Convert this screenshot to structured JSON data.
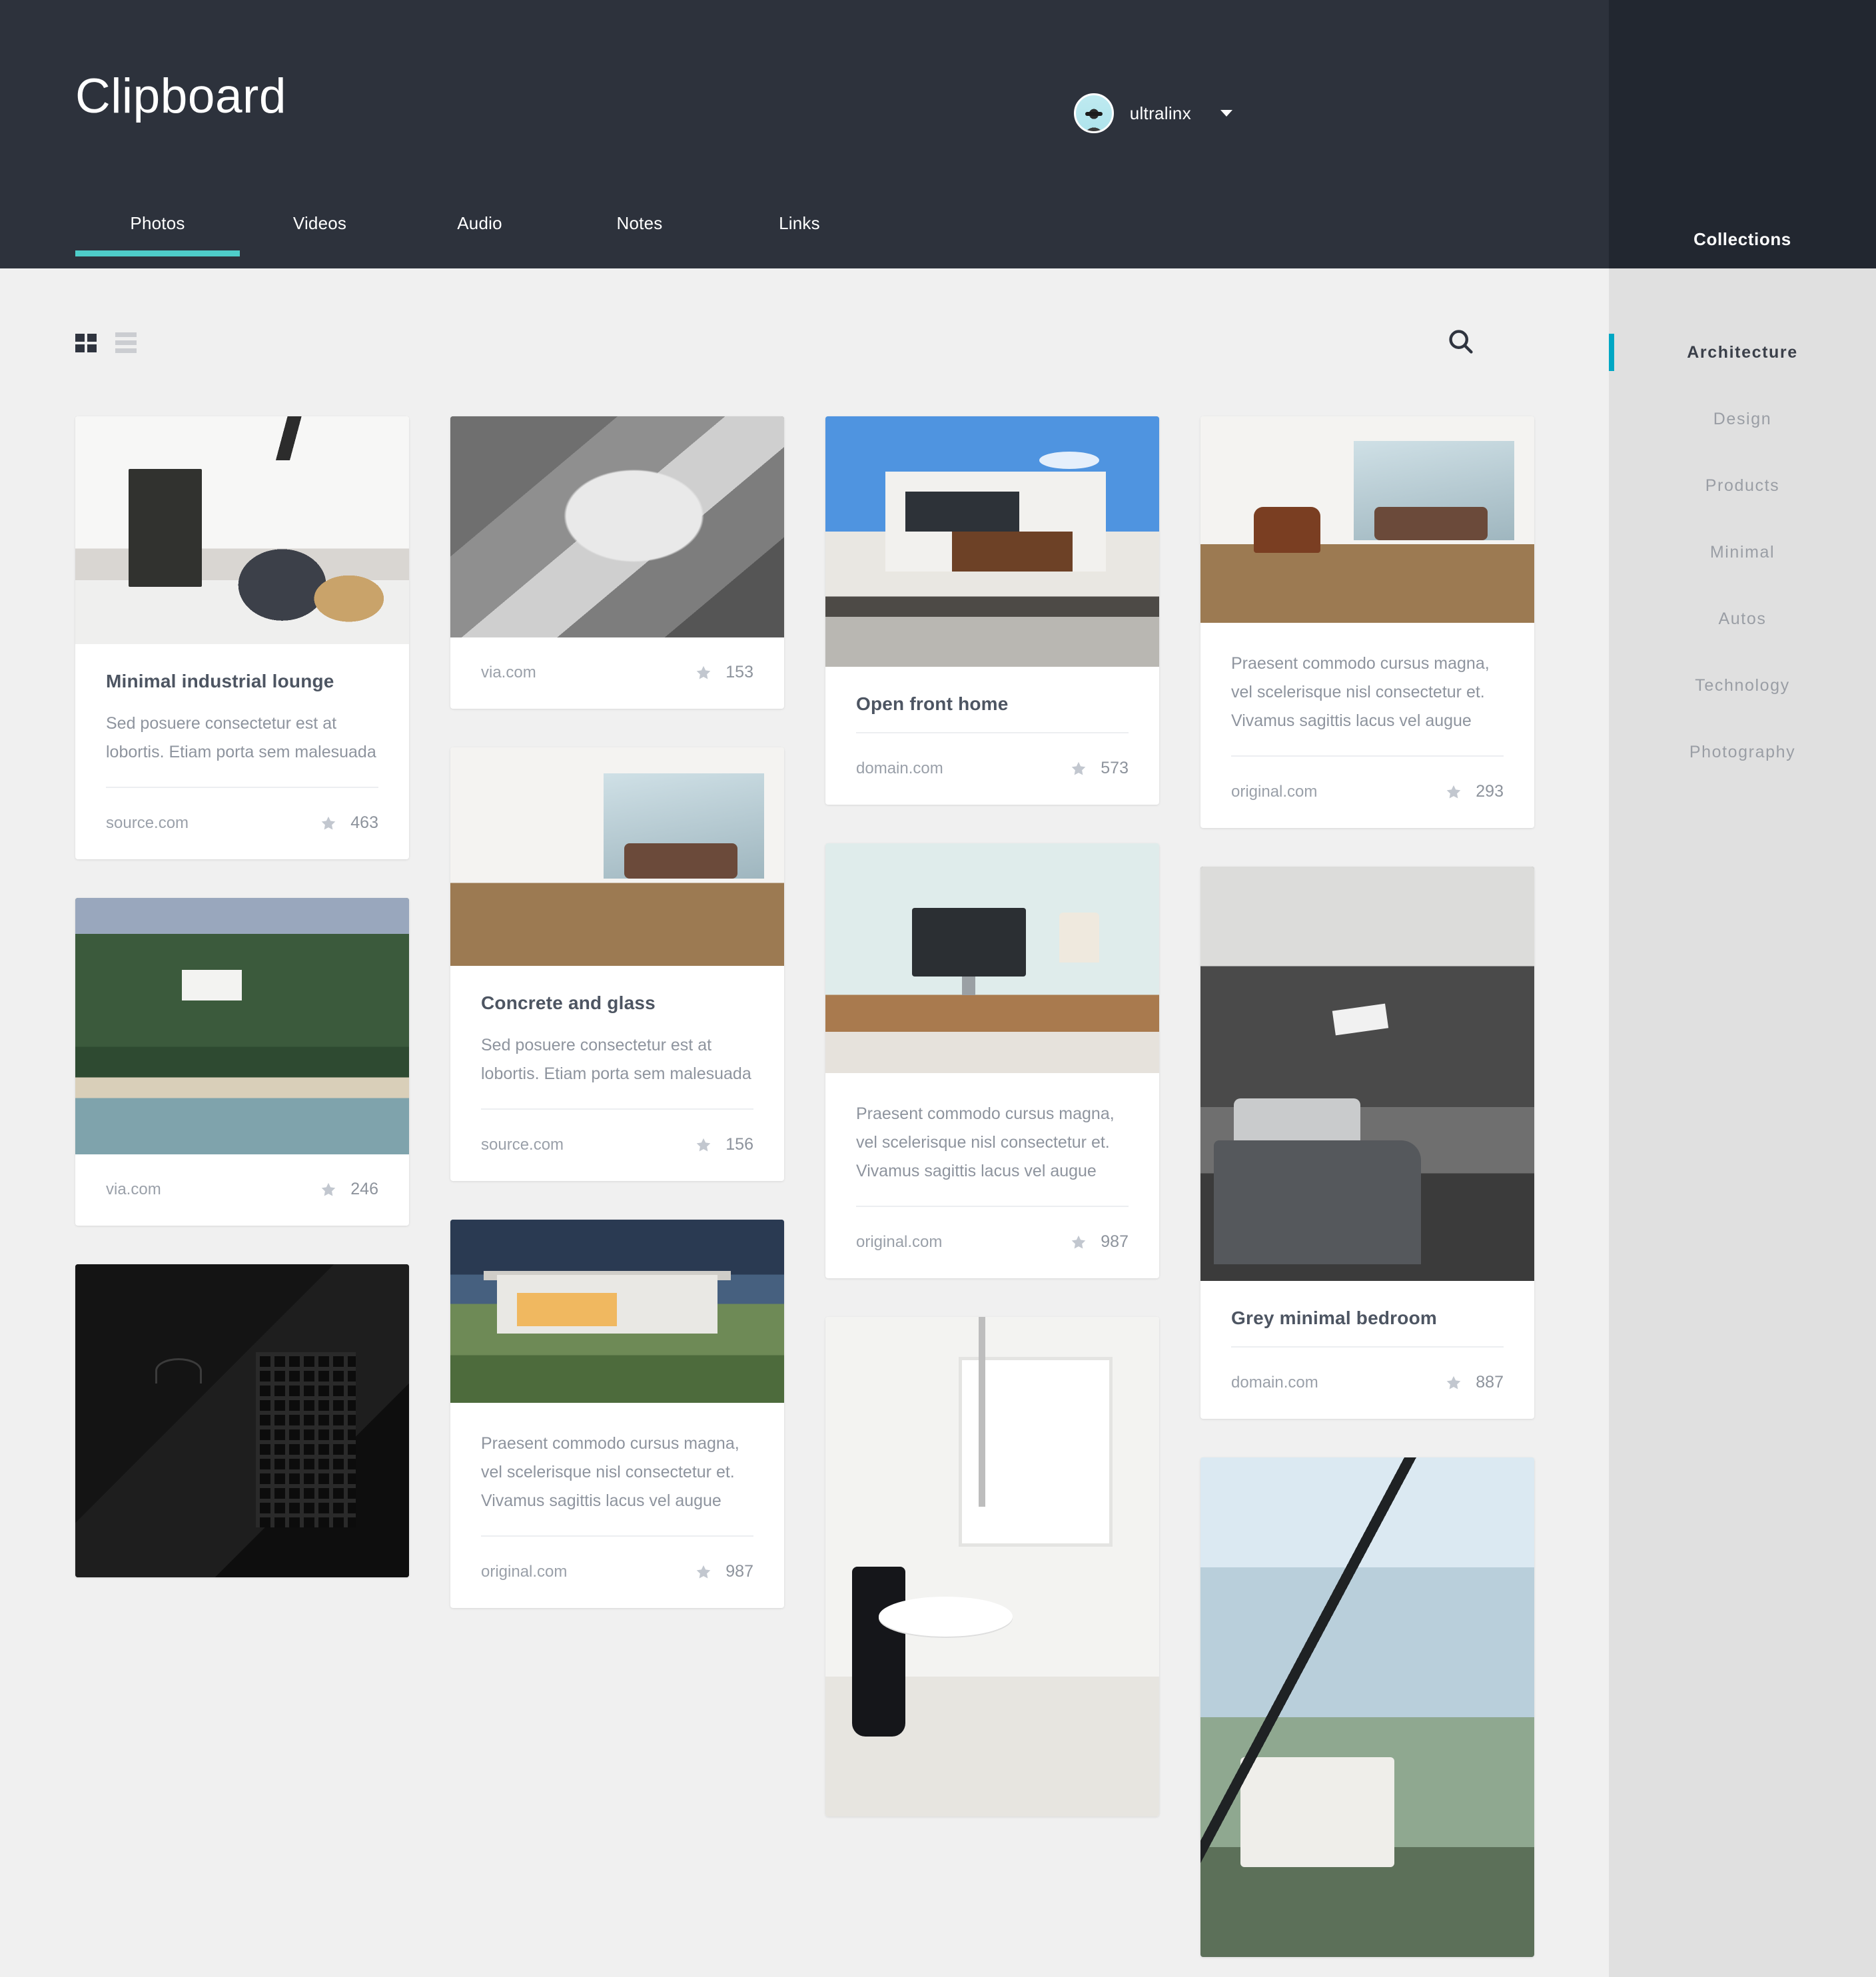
{
  "header": {
    "title": "Clipboard",
    "user": {
      "name": "ultralinx",
      "avatar_alt": "user-avatar",
      "caret": "chevron-down-icon"
    },
    "tabs": [
      {
        "label": "Photos",
        "active": true
      },
      {
        "label": "Videos",
        "active": false
      },
      {
        "label": "Audio",
        "active": false
      },
      {
        "label": "Notes",
        "active": false
      },
      {
        "label": "Links",
        "active": false
      }
    ]
  },
  "toolbar": {
    "grid_view": "grid-view-icon",
    "list_view": "list-view-icon",
    "search": "search-icon"
  },
  "sidebar": {
    "title": "Collections",
    "items": [
      {
        "label": "Architecture",
        "active": true
      },
      {
        "label": "Design",
        "active": false
      },
      {
        "label": "Products",
        "active": false
      },
      {
        "label": "Minimal",
        "active": false
      },
      {
        "label": "Autos",
        "active": false
      },
      {
        "label": "Technology",
        "active": false
      },
      {
        "label": "Photography",
        "active": false
      }
    ]
  },
  "colors": {
    "header_bg": "#2d323c",
    "sidebar_header_bg": "#222730",
    "sidebar_bg": "#e0e0e0",
    "page_bg": "#f0f0f0",
    "accent_tab": "#4ecdc9",
    "accent_collection": "#00a7c4",
    "card_bg": "#ffffff",
    "title_text": "#4d5562",
    "muted_text": "#9aa0a9"
  },
  "columns": [
    {
      "cards": [
        {
          "id": "c1",
          "art": "p-lounge",
          "thumb_h": 342,
          "title": "Minimal industrial lounge",
          "desc": "Sed posuere consectetur est at lobortis. Etiam porta sem malesuada",
          "source": "source.com",
          "stars": "463"
        },
        {
          "id": "c2",
          "art": "p-forest",
          "thumb_h": 385,
          "title": "",
          "desc": "",
          "source": "via.com",
          "stars": "246"
        },
        {
          "id": "c3",
          "art": "p-dark",
          "thumb_h": 470,
          "title": "",
          "desc": "",
          "source": "",
          "stars": ""
        }
      ]
    },
    {
      "cards": [
        {
          "id": "c4",
          "art": "p-concrete",
          "thumb_h": 332,
          "title": "",
          "desc": "",
          "source": "via.com",
          "stars": "153"
        },
        {
          "id": "c5",
          "art": "p-glassbldg",
          "thumb_h": 328,
          "title": "Concrete and glass",
          "desc": "Sed posuere consectetur est at lobortis. Etiam porta sem malesuada",
          "source": "source.com",
          "stars": "156"
        },
        {
          "id": "c6",
          "art": "p-villa",
          "thumb_h": 275,
          "title": "",
          "desc": "Praesent commodo cursus magna, vel scelerisque nisl consectetur et. Vivamus sagittis lacus vel augue",
          "source": "original.com",
          "stars": "987"
        }
      ]
    },
    {
      "cards": [
        {
          "id": "c7",
          "art": "p-openfront",
          "thumb_h": 376,
          "title": "Open front home",
          "desc": "",
          "source": "domain.com",
          "stars": "573"
        },
        {
          "id": "c8",
          "art": "p-desk",
          "thumb_h": 345,
          "title": "",
          "desc": "Praesent commodo cursus magna, vel scelerisque nisl consectetur et. Vivamus sagittis lacus vel augue",
          "source": "original.com",
          "stars": "987"
        },
        {
          "id": "c9",
          "art": "p-dining",
          "thumb_h": 750,
          "title": "",
          "desc": "",
          "source": "",
          "stars": ""
        }
      ]
    },
    {
      "cards": [
        {
          "id": "c10",
          "art": "p-apartment",
          "thumb_h": 310,
          "title": "",
          "desc": "Praesent commodo cursus magna, vel scelerisque nisl consectetur et. Vivamus sagittis lacus vel augue",
          "source": "original.com",
          "stars": "293"
        },
        {
          "id": "c11",
          "art": "p-bedroom",
          "thumb_h": 622,
          "title": "Grey minimal bedroom",
          "desc": "",
          "source": "domain.com",
          "stars": "887"
        },
        {
          "id": "c12",
          "art": "p-glasshouse",
          "thumb_h": 750,
          "title": "",
          "desc": "",
          "source": "",
          "stars": ""
        }
      ]
    }
  ]
}
